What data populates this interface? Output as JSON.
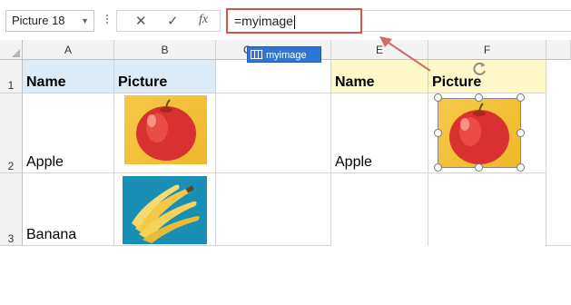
{
  "formula_bar": {
    "name_box": "Picture 18",
    "cancel_icon": "✕",
    "enter_icon": "✓",
    "fx_label": "fx",
    "formula": "=myimage"
  },
  "autocomplete": {
    "label": "myimage"
  },
  "columns": [
    "A",
    "B",
    "C",
    "E",
    "F"
  ],
  "rows": [
    "1",
    "2",
    "3"
  ],
  "left_table": {
    "header": [
      "Name",
      "Picture"
    ],
    "items": [
      {
        "name": "Apple",
        "picture": "apple"
      },
      {
        "name": "Banana",
        "picture": "banana"
      }
    ]
  },
  "right_table": {
    "header": [
      "Name",
      "Picture"
    ],
    "items": [
      {
        "name": "Apple",
        "picture": "apple"
      }
    ]
  },
  "colors": {
    "accent_red": "#d9534f",
    "header_blue": "#ddebf7",
    "header_yellow": "#fff9c9",
    "autocomplete_blue": "#2f75d6"
  }
}
